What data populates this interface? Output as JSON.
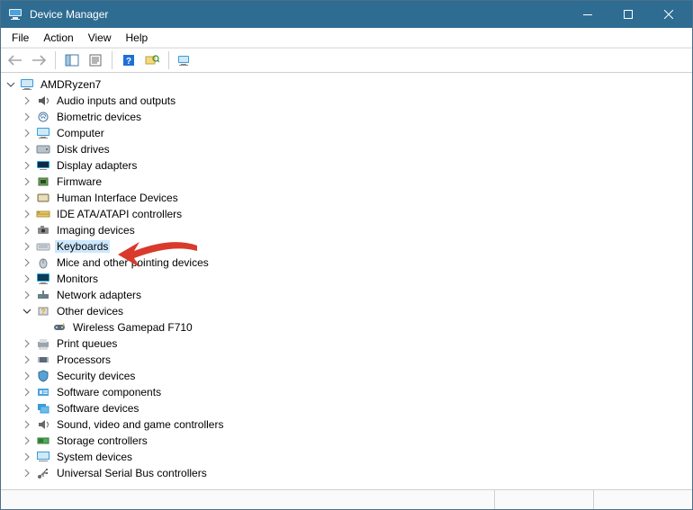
{
  "window": {
    "title": "Device Manager"
  },
  "menu": {
    "file": "File",
    "action": "Action",
    "view": "View",
    "help": "Help"
  },
  "tree": {
    "root": "AMDRyzen7",
    "categories": [
      {
        "label": "Audio inputs and outputs"
      },
      {
        "label": "Biometric devices"
      },
      {
        "label": "Computer"
      },
      {
        "label": "Disk drives"
      },
      {
        "label": "Display adapters"
      },
      {
        "label": "Firmware"
      },
      {
        "label": "Human Interface Devices"
      },
      {
        "label": "IDE ATA/ATAPI controllers"
      },
      {
        "label": "Imaging devices"
      },
      {
        "label": "Keyboards",
        "selected": true
      },
      {
        "label": "Mice and other pointing devices"
      },
      {
        "label": "Monitors"
      },
      {
        "label": "Network adapters"
      },
      {
        "label": "Other devices",
        "expanded": true,
        "children": [
          {
            "label": "Wireless Gamepad F710"
          }
        ]
      },
      {
        "label": "Print queues"
      },
      {
        "label": "Processors"
      },
      {
        "label": "Security devices"
      },
      {
        "label": "Software components"
      },
      {
        "label": "Software devices"
      },
      {
        "label": "Sound, video and game controllers"
      },
      {
        "label": "Storage controllers"
      },
      {
        "label": "System devices"
      },
      {
        "label": "Universal Serial Bus controllers"
      }
    ]
  }
}
